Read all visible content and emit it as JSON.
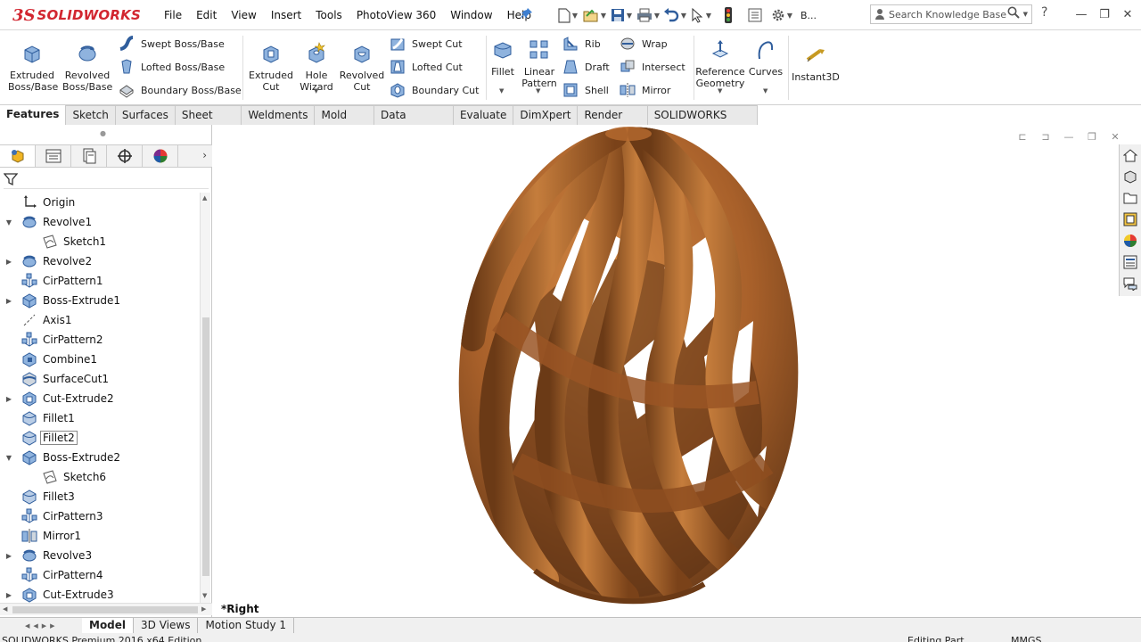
{
  "app": {
    "logo_mark": "3S",
    "logo_text": "SOLIDWORKS"
  },
  "menu": [
    "File",
    "Edit",
    "View",
    "Insert",
    "Tools",
    "PhotoView 360",
    "Window",
    "Help"
  ],
  "quick_access": {
    "rebuild_hint": "B..."
  },
  "search": {
    "placeholder": "Search Knowledge Base"
  },
  "help_label": "?",
  "ribbon": {
    "extruded_boss": "Extruded Boss/Base",
    "revolved_boss": "Revolved Boss/Base",
    "swept_boss": "Swept Boss/Base",
    "lofted_boss": "Lofted Boss/Base",
    "boundary_boss": "Boundary Boss/Base",
    "extruded_cut": "Extruded Cut",
    "hole_wizard": "Hole Wizard",
    "revolved_cut": "Revolved Cut",
    "swept_cut": "Swept Cut",
    "lofted_cut": "Lofted Cut",
    "boundary_cut": "Boundary Cut",
    "fillet": "Fillet",
    "linear_pattern": "Linear Pattern",
    "rib": "Rib",
    "draft": "Draft",
    "shell": "Shell",
    "wrap": "Wrap",
    "intersect": "Intersect",
    "mirror": "Mirror",
    "reference_geometry": "Reference Geometry",
    "curves": "Curves",
    "instant3d": "Instant3D"
  },
  "tabs": [
    {
      "label": "Features",
      "active": true
    },
    {
      "label": "Sketch",
      "active": false
    },
    {
      "label": "Surfaces",
      "active": false
    },
    {
      "label": "Sheet Metal",
      "active": false
    },
    {
      "label": "Weldments",
      "active": false
    },
    {
      "label": "Mold Tools",
      "active": false
    },
    {
      "label": "Data Migration",
      "active": false
    },
    {
      "label": "Evaluate",
      "active": false
    },
    {
      "label": "DimXpert",
      "active": false
    },
    {
      "label": "Render Tools",
      "active": false
    },
    {
      "label": "SOLIDWORKS Add-Ins",
      "active": false
    }
  ],
  "tree": [
    {
      "label": "Origin",
      "icon": "origin-icon",
      "level": 0,
      "expander": "none"
    },
    {
      "label": "Revolve1",
      "icon": "revolve-icon",
      "level": 0,
      "expander": "expanded"
    },
    {
      "label": "Sketch1",
      "icon": "sketch-icon",
      "level": 1,
      "expander": "none"
    },
    {
      "label": "Revolve2",
      "icon": "revolve-icon",
      "level": 0,
      "expander": "collapsed"
    },
    {
      "label": "CirPattern1",
      "icon": "circular-pattern-icon",
      "level": 0,
      "expander": "none"
    },
    {
      "label": "Boss-Extrude1",
      "icon": "extrude-icon",
      "level": 0,
      "expander": "collapsed"
    },
    {
      "label": "Axis1",
      "icon": "axis-icon",
      "level": 0,
      "expander": "none"
    },
    {
      "label": "CirPattern2",
      "icon": "circular-pattern-icon",
      "level": 0,
      "expander": "none"
    },
    {
      "label": "Combine1",
      "icon": "combine-icon",
      "level": 0,
      "expander": "none"
    },
    {
      "label": "SurfaceCut1",
      "icon": "surface-cut-icon",
      "level": 0,
      "expander": "none"
    },
    {
      "label": "Cut-Extrude2",
      "icon": "cut-extrude-icon",
      "level": 0,
      "expander": "collapsed"
    },
    {
      "label": "Fillet1",
      "icon": "fillet-icon",
      "level": 0,
      "expander": "none"
    },
    {
      "label": "Fillet2",
      "icon": "fillet-icon",
      "level": 0,
      "expander": "none",
      "selected": true
    },
    {
      "label": "Boss-Extrude2",
      "icon": "extrude-icon",
      "level": 0,
      "expander": "expanded"
    },
    {
      "label": "Sketch6",
      "icon": "sketch-icon",
      "level": 1,
      "expander": "none"
    },
    {
      "label": "Fillet3",
      "icon": "fillet-icon",
      "level": 0,
      "expander": "none"
    },
    {
      "label": "CirPattern3",
      "icon": "circular-pattern-icon",
      "level": 0,
      "expander": "none"
    },
    {
      "label": "Mirror1",
      "icon": "mirror-icon",
      "level": 0,
      "expander": "none"
    },
    {
      "label": "Revolve3",
      "icon": "revolve-icon",
      "level": 0,
      "expander": "collapsed"
    },
    {
      "label": "CirPattern4",
      "icon": "circular-pattern-icon",
      "level": 0,
      "expander": "none"
    },
    {
      "label": "Cut-Extrude3",
      "icon": "cut-extrude-icon",
      "level": 0,
      "expander": "collapsed"
    }
  ],
  "viewport": {
    "view_name": "*Right"
  },
  "bottom_tabs": [
    {
      "label": "Model",
      "active": true
    },
    {
      "label": "3D Views",
      "active": false
    },
    {
      "label": "Motion Study 1",
      "active": false
    }
  ],
  "status": {
    "product": "SOLIDWORKS Premium 2016 x64 Edition",
    "editing": "Editing Part",
    "units": "MMGS"
  },
  "colors": {
    "brand": "#d22630",
    "model_wood": "#a8602a",
    "icon_blue": "#3f6fb0"
  }
}
